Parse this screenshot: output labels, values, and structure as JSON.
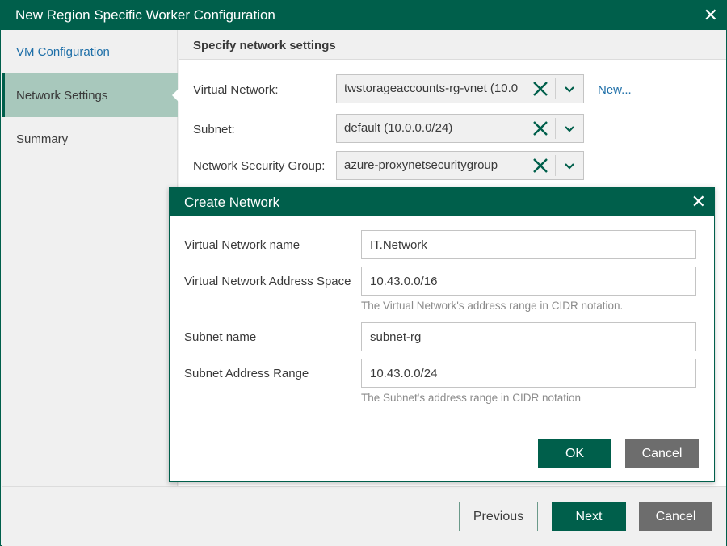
{
  "window": {
    "title": "New Region Specific Worker Configuration"
  },
  "sidebar": {
    "items": [
      {
        "label": "VM Configuration"
      },
      {
        "label": "Network Settings"
      },
      {
        "label": "Summary"
      }
    ]
  },
  "page": {
    "heading": "Specify network settings",
    "virtual_network": {
      "label": "Virtual Network:",
      "value": "twstorageaccounts-rg-vnet (10.0"
    },
    "subnet": {
      "label": "Subnet:",
      "value": "default (10.0.0.0/24)"
    },
    "security_group": {
      "label": "Network Security Group:",
      "value": "azure-proxynetsecuritygroup"
    },
    "new_link": "New..."
  },
  "footer": {
    "previous": "Previous",
    "next": "Next",
    "cancel": "Cancel"
  },
  "dialog": {
    "title": "Create Network",
    "vnet_name": {
      "label": "Virtual Network name",
      "value": "IT.Network"
    },
    "vnet_space": {
      "label": "Virtual Network Address Space",
      "value": "10.43.0.0/16",
      "hint": "The Virtual Network's address range in CIDR notation."
    },
    "subnet_name": {
      "label": "Subnet name",
      "value": "subnet-rg"
    },
    "subnet_range": {
      "label": "Subnet Address Range",
      "value": "10.43.0.0/24",
      "hint": "The Subnet's address range in CIDR notation"
    },
    "ok": "OK",
    "cancel": "Cancel"
  },
  "colors": {
    "brand": "#005f4b",
    "active_nav": "#a8c8bc",
    "link": "#1e6fa8",
    "cancel_gray": "#6d6d6d"
  },
  "icons": {
    "close": "close-icon",
    "clear": "clear-x-icon",
    "dropdown": "chevron-down-icon"
  }
}
